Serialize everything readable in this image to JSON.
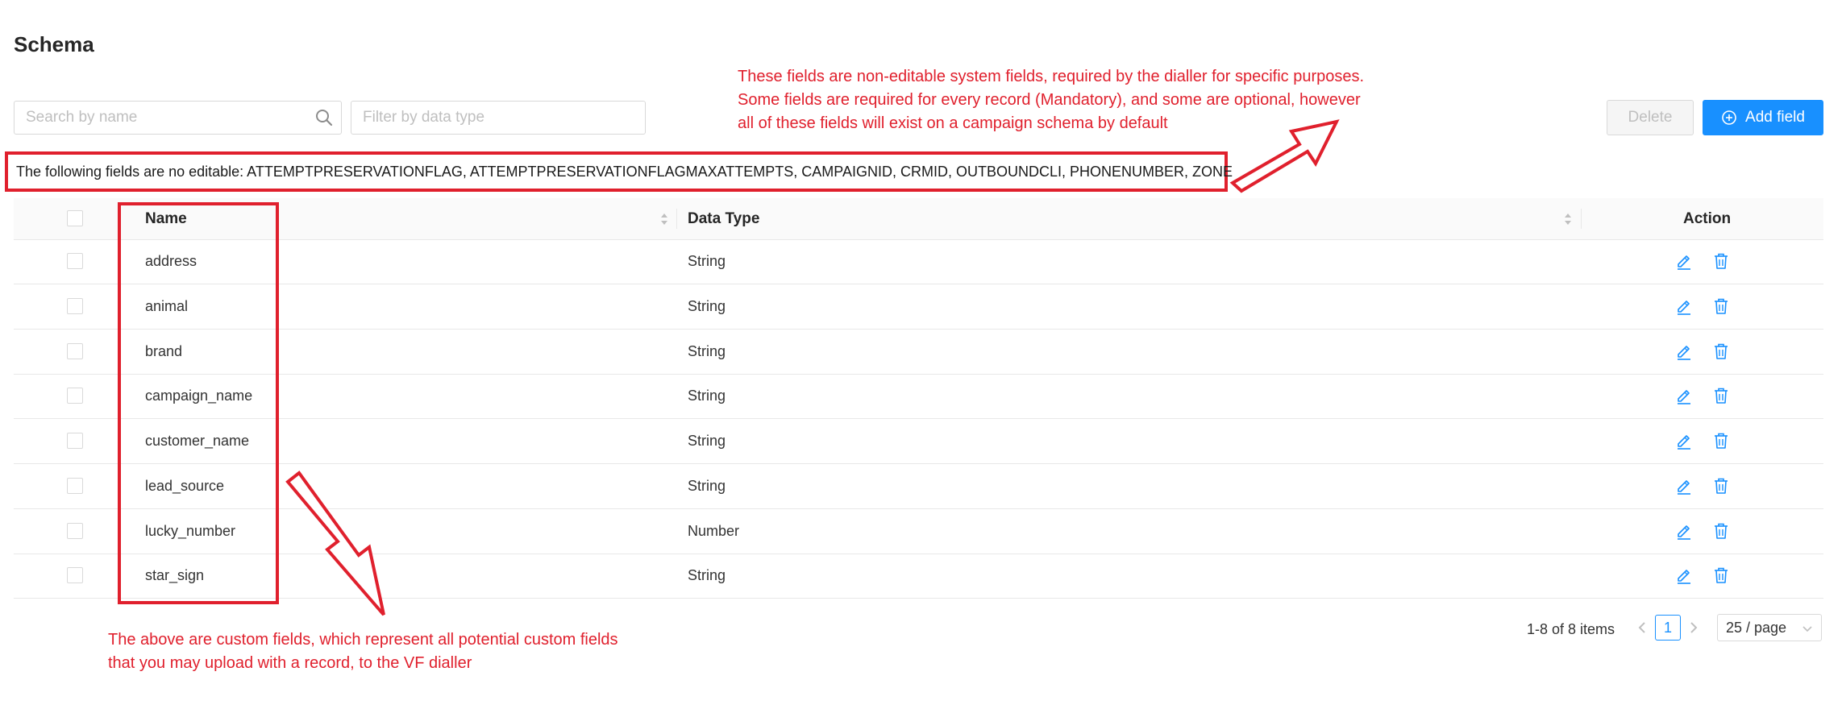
{
  "page": {
    "title": "Schema"
  },
  "toolbar": {
    "search_placeholder": "Search by name",
    "filter_placeholder": "Filter by data type",
    "delete_label": "Delete",
    "add_label": "Add field"
  },
  "notice": {
    "text": "The following fields are no editable: ATTEMPTPRESERVATIONFLAG, ATTEMPTPRESERVATIONFLAGMAXATTEMPTS, CAMPAIGNID, CRMID, OUTBOUNDCLI, PHONENUMBER, ZONE"
  },
  "table": {
    "columns": {
      "name": "Name",
      "data_type": "Data Type",
      "action": "Action"
    },
    "rows": [
      {
        "name": "address",
        "data_type": "String"
      },
      {
        "name": "animal",
        "data_type": "String"
      },
      {
        "name": "brand",
        "data_type": "String"
      },
      {
        "name": "campaign_name",
        "data_type": "String"
      },
      {
        "name": "customer_name",
        "data_type": "String"
      },
      {
        "name": "lead_source",
        "data_type": "String"
      },
      {
        "name": "lucky_number",
        "data_type": "Number"
      },
      {
        "name": "star_sign",
        "data_type": "String"
      }
    ]
  },
  "pagination": {
    "summary": "1-8 of 8 items",
    "current_page": "1",
    "page_size": "25 / page"
  },
  "annotations": {
    "top": [
      "These fields are non-editable system fields, required by the dialler for specific purposes.",
      "Some fields are required for every record (Mandatory), and some are optional, however",
      "all of these fields will exist on a campaign schema by default"
    ],
    "bottom": [
      "The above are custom fields, which represent all potential custom fields",
      "that you may upload with a record, to the VF dialler"
    ]
  },
  "colors": {
    "accent": "#1890ff",
    "annotation": "#e0202d",
    "border": "#d9d9d9"
  },
  "icons": [
    "search-icon",
    "plus-circle-icon",
    "edit-icon",
    "delete-icon",
    "sort-icon",
    "chevron-left-icon",
    "chevron-right-icon",
    "chevron-down-icon"
  ]
}
